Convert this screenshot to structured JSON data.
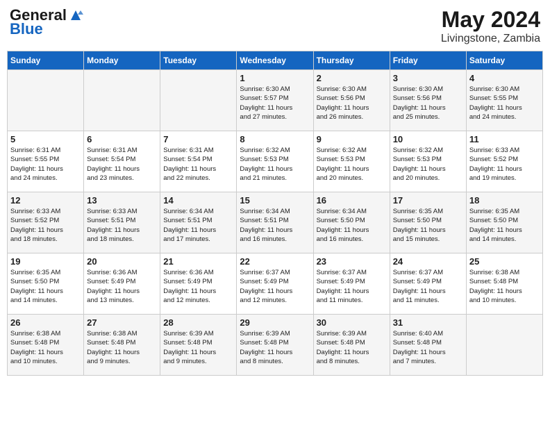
{
  "header": {
    "logo_line1": "General",
    "logo_line2": "Blue",
    "month_year": "May 2024",
    "location": "Livingstone, Zambia"
  },
  "days_of_week": [
    "Sunday",
    "Monday",
    "Tuesday",
    "Wednesday",
    "Thursday",
    "Friday",
    "Saturday"
  ],
  "weeks": [
    [
      {
        "day": "",
        "info": ""
      },
      {
        "day": "",
        "info": ""
      },
      {
        "day": "",
        "info": ""
      },
      {
        "day": "1",
        "info": "Sunrise: 6:30 AM\nSunset: 5:57 PM\nDaylight: 11 hours\nand 27 minutes."
      },
      {
        "day": "2",
        "info": "Sunrise: 6:30 AM\nSunset: 5:56 PM\nDaylight: 11 hours\nand 26 minutes."
      },
      {
        "day": "3",
        "info": "Sunrise: 6:30 AM\nSunset: 5:56 PM\nDaylight: 11 hours\nand 25 minutes."
      },
      {
        "day": "4",
        "info": "Sunrise: 6:30 AM\nSunset: 5:55 PM\nDaylight: 11 hours\nand 24 minutes."
      }
    ],
    [
      {
        "day": "5",
        "info": "Sunrise: 6:31 AM\nSunset: 5:55 PM\nDaylight: 11 hours\nand 24 minutes."
      },
      {
        "day": "6",
        "info": "Sunrise: 6:31 AM\nSunset: 5:54 PM\nDaylight: 11 hours\nand 23 minutes."
      },
      {
        "day": "7",
        "info": "Sunrise: 6:31 AM\nSunset: 5:54 PM\nDaylight: 11 hours\nand 22 minutes."
      },
      {
        "day": "8",
        "info": "Sunrise: 6:32 AM\nSunset: 5:53 PM\nDaylight: 11 hours\nand 21 minutes."
      },
      {
        "day": "9",
        "info": "Sunrise: 6:32 AM\nSunset: 5:53 PM\nDaylight: 11 hours\nand 20 minutes."
      },
      {
        "day": "10",
        "info": "Sunrise: 6:32 AM\nSunset: 5:53 PM\nDaylight: 11 hours\nand 20 minutes."
      },
      {
        "day": "11",
        "info": "Sunrise: 6:33 AM\nSunset: 5:52 PM\nDaylight: 11 hours\nand 19 minutes."
      }
    ],
    [
      {
        "day": "12",
        "info": "Sunrise: 6:33 AM\nSunset: 5:52 PM\nDaylight: 11 hours\nand 18 minutes."
      },
      {
        "day": "13",
        "info": "Sunrise: 6:33 AM\nSunset: 5:51 PM\nDaylight: 11 hours\nand 18 minutes."
      },
      {
        "day": "14",
        "info": "Sunrise: 6:34 AM\nSunset: 5:51 PM\nDaylight: 11 hours\nand 17 minutes."
      },
      {
        "day": "15",
        "info": "Sunrise: 6:34 AM\nSunset: 5:51 PM\nDaylight: 11 hours\nand 16 minutes."
      },
      {
        "day": "16",
        "info": "Sunrise: 6:34 AM\nSunset: 5:50 PM\nDaylight: 11 hours\nand 16 minutes."
      },
      {
        "day": "17",
        "info": "Sunrise: 6:35 AM\nSunset: 5:50 PM\nDaylight: 11 hours\nand 15 minutes."
      },
      {
        "day": "18",
        "info": "Sunrise: 6:35 AM\nSunset: 5:50 PM\nDaylight: 11 hours\nand 14 minutes."
      }
    ],
    [
      {
        "day": "19",
        "info": "Sunrise: 6:35 AM\nSunset: 5:50 PM\nDaylight: 11 hours\nand 14 minutes."
      },
      {
        "day": "20",
        "info": "Sunrise: 6:36 AM\nSunset: 5:49 PM\nDaylight: 11 hours\nand 13 minutes."
      },
      {
        "day": "21",
        "info": "Sunrise: 6:36 AM\nSunset: 5:49 PM\nDaylight: 11 hours\nand 12 minutes."
      },
      {
        "day": "22",
        "info": "Sunrise: 6:37 AM\nSunset: 5:49 PM\nDaylight: 11 hours\nand 12 minutes."
      },
      {
        "day": "23",
        "info": "Sunrise: 6:37 AM\nSunset: 5:49 PM\nDaylight: 11 hours\nand 11 minutes."
      },
      {
        "day": "24",
        "info": "Sunrise: 6:37 AM\nSunset: 5:49 PM\nDaylight: 11 hours\nand 11 minutes."
      },
      {
        "day": "25",
        "info": "Sunrise: 6:38 AM\nSunset: 5:48 PM\nDaylight: 11 hours\nand 10 minutes."
      }
    ],
    [
      {
        "day": "26",
        "info": "Sunrise: 6:38 AM\nSunset: 5:48 PM\nDaylight: 11 hours\nand 10 minutes."
      },
      {
        "day": "27",
        "info": "Sunrise: 6:38 AM\nSunset: 5:48 PM\nDaylight: 11 hours\nand 9 minutes."
      },
      {
        "day": "28",
        "info": "Sunrise: 6:39 AM\nSunset: 5:48 PM\nDaylight: 11 hours\nand 9 minutes."
      },
      {
        "day": "29",
        "info": "Sunrise: 6:39 AM\nSunset: 5:48 PM\nDaylight: 11 hours\nand 8 minutes."
      },
      {
        "day": "30",
        "info": "Sunrise: 6:39 AM\nSunset: 5:48 PM\nDaylight: 11 hours\nand 8 minutes."
      },
      {
        "day": "31",
        "info": "Sunrise: 6:40 AM\nSunset: 5:48 PM\nDaylight: 11 hours\nand 7 minutes."
      },
      {
        "day": "",
        "info": ""
      }
    ]
  ]
}
